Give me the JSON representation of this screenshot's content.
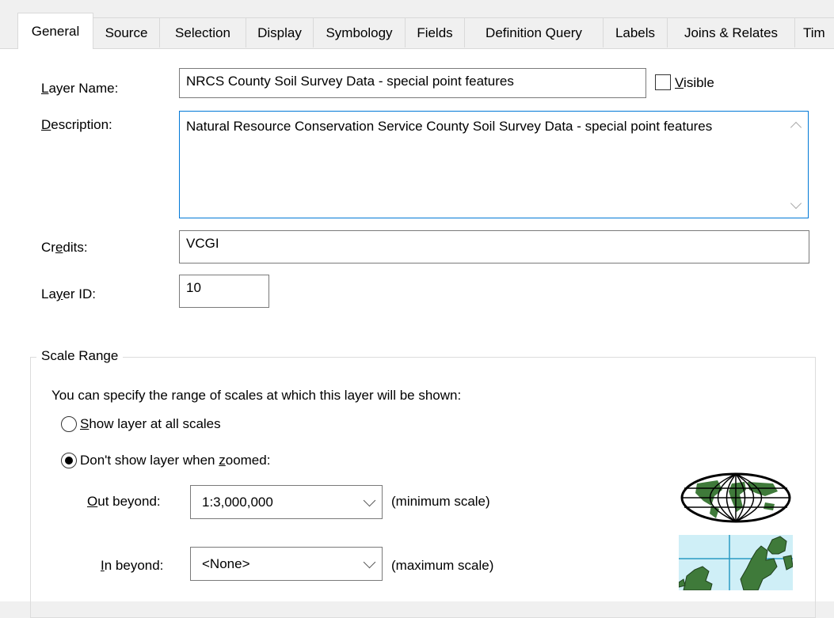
{
  "tabs": [
    {
      "label": "General",
      "active": true
    },
    {
      "label": "Source"
    },
    {
      "label": "Selection"
    },
    {
      "label": "Display"
    },
    {
      "label": "Symbology"
    },
    {
      "label": "Fields"
    },
    {
      "label": "Definition Query"
    },
    {
      "label": "Labels"
    },
    {
      "label": "Joins & Relates"
    },
    {
      "label": "Tim"
    }
  ],
  "general": {
    "layer_name_label_pre": "",
    "layer_name_label_key": "L",
    "layer_name_label_post": "ayer Name:",
    "layer_name_value": "NRCS County Soil Survey Data - special point features",
    "visible_label_key": "V",
    "visible_label_post": "isible",
    "visible_checked": false,
    "description_label_key": "D",
    "description_label_post": "escription:",
    "description_value": "Natural Resource Conservation Service County Soil Survey Data - special point features",
    "credits_label_pre": "Cr",
    "credits_label_key": "e",
    "credits_label_post": "dits:",
    "credits_value": "VCGI",
    "layer_id_label_pre": "La",
    "layer_id_label_key": "y",
    "layer_id_label_post": "er ID:",
    "layer_id_value": "10"
  },
  "scale_range": {
    "title": "Scale Range",
    "instructions": "You can specify the range of scales at which this layer will be shown:",
    "option_all_key": "S",
    "option_all_post": "how layer at all scales",
    "option_all_selected": false,
    "option_zoom_pre": "Don't show layer when ",
    "option_zoom_key": "z",
    "option_zoom_post": "oomed:",
    "option_zoom_selected": true,
    "out_beyond_key": "O",
    "out_beyond_post": "ut beyond:",
    "out_beyond_value": "1:3,000,000",
    "out_beyond_note": "(minimum scale)",
    "in_beyond_key": "I",
    "in_beyond_post": "n beyond:",
    "in_beyond_value": "<None>",
    "in_beyond_note": "(maximum scale)"
  },
  "icons": {
    "globe": "globe-icon",
    "map": "europe-map-icon",
    "land_color": "#3f7a3a",
    "water_color": "#cfeff7"
  }
}
